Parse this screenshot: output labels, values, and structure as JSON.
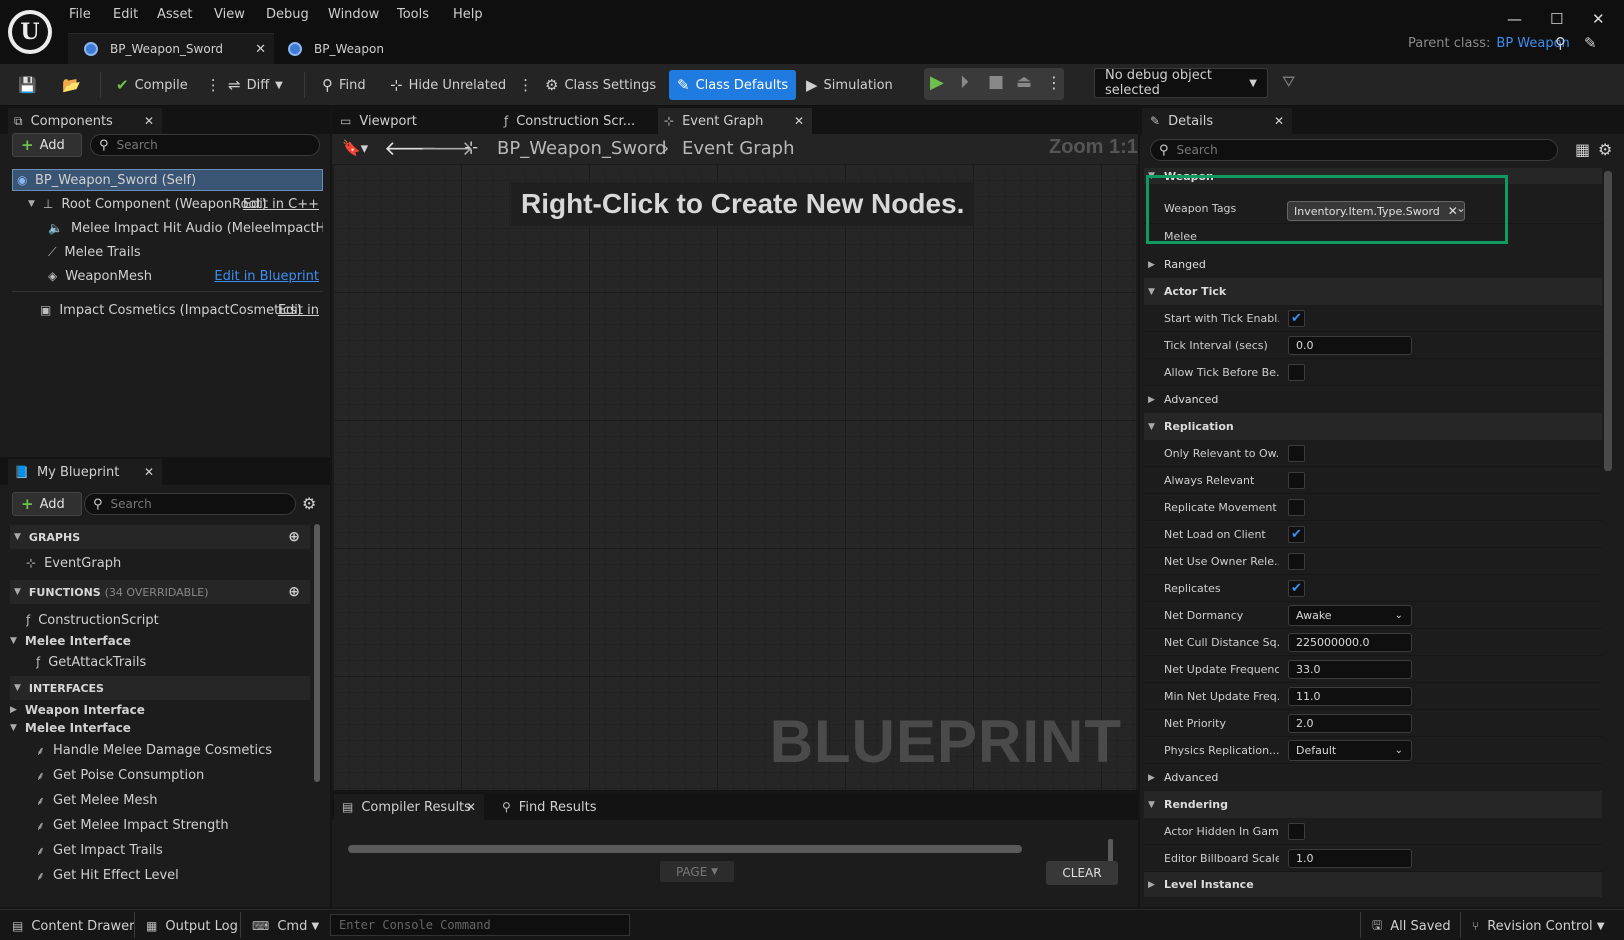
{
  "menu": [
    "File",
    "Edit",
    "Asset",
    "View",
    "Debug",
    "Window",
    "Tools",
    "Help"
  ],
  "tabs": [
    {
      "label": "BP_Weapon_Sword"
    },
    {
      "label": "BP_Weapon"
    }
  ],
  "parent_class": {
    "label": "Parent class:",
    "value": "BP Weapon"
  },
  "toolbar": {
    "compile": "Compile",
    "diff": "Diff",
    "find": "Find",
    "hide_unrelated": "Hide Unrelated",
    "class_settings": "Class Settings",
    "class_defaults": "Class Defaults",
    "simulation": "Simulation",
    "debug_object": "No debug object selected"
  },
  "components": {
    "title": "Components",
    "add": "Add",
    "search_placeholder": "Search",
    "items": [
      {
        "label": "BP_Weapon_Sword (Self)"
      },
      {
        "label": "Root Component (WeaponRoot)",
        "action": "Edit in C++"
      },
      {
        "label": "Melee Impact Hit Audio (MeleeImpactHitAuc"
      },
      {
        "label": "Melee Trails"
      },
      {
        "label": "WeaponMesh",
        "action": "Edit in Blueprint"
      },
      {
        "label": "Impact Cosmetics (ImpactCosmetics)",
        "action": "Edit in"
      }
    ]
  },
  "my_blueprint": {
    "title": "My Blueprint",
    "add": "Add",
    "search_placeholder": "Search",
    "graphs_header": "GRAPHS",
    "event_graph": "EventGraph",
    "functions_header": "FUNCTIONS",
    "functions_count": "(34 OVERRIDABLE)",
    "construction_script": "ConstructionScript",
    "melee_interface_cat": "Melee Interface",
    "get_attack_trails": "GetAttackTrails",
    "interfaces_header": "INTERFACES",
    "weapon_interface": "Weapon Interface",
    "melee_interface": "Melee Interface",
    "interface_funcs": [
      "Handle Melee Damage Cosmetics",
      "Get Poise Consumption",
      "Get Melee Mesh",
      "Get Melee Impact Strength",
      "Get Impact Trails",
      "Get Hit Effect Level"
    ]
  },
  "graph_tabs": [
    {
      "label": "Viewport"
    },
    {
      "label": "Construction Scr..."
    },
    {
      "label": "Event Graph"
    }
  ],
  "graph": {
    "breadcrumb_root": "BP_Weapon_Sword",
    "breadcrumb_current": "Event Graph",
    "zoom": "Zoom 1:1",
    "hint": "Right-Click to Create New Nodes.",
    "watermark": "BLUEPRINT"
  },
  "bottom": {
    "compiler_results": "Compiler Results",
    "find_results": "Find Results",
    "page": "PAGE",
    "clear": "CLEAR"
  },
  "details": {
    "title": "Details",
    "search_placeholder": "Search",
    "weapon_section": "Weapon",
    "weapon_tags_label": "Weapon Tags",
    "weapon_tag": "Inventory.Item.Type.Sword",
    "melee_partial": "Melee",
    "ranged": "Ranged",
    "actor_tick": "Actor Tick",
    "start_tick": "Start with Tick Enabl...",
    "tick_interval": "Tick Interval (secs)",
    "tick_interval_val": "0.0",
    "allow_tick": "Allow Tick Before Be...",
    "advanced1": "Advanced",
    "replication": "Replication",
    "only_relevant": "Only Relevant to Ow...",
    "always_relevant": "Always Relevant",
    "replicate_movement": "Replicate Movement",
    "net_load": "Net Load on Client",
    "net_use_owner": "Net Use Owner Rele...",
    "replicates": "Replicates",
    "net_dormancy": "Net Dormancy",
    "net_dormancy_val": "Awake",
    "net_cull": "Net Cull Distance Sq...",
    "net_cull_val": "225000000.0",
    "net_update": "Net Update Frequency",
    "net_update_val": "33.0",
    "min_net_update": "Min Net Update Freq...",
    "min_net_update_val": "11.0",
    "net_priority": "Net Priority",
    "net_priority_val": "2.0",
    "physics_rep": "Physics Replication...",
    "physics_rep_val": "Default",
    "advanced2": "Advanced",
    "rendering": "Rendering",
    "actor_hidden": "Actor Hidden In Game",
    "billboard_scale": "Editor Billboard Scale",
    "billboard_scale_val": "1.0",
    "level_instance": "Level Instance"
  },
  "status": {
    "content_drawer": "Content Drawer",
    "output_log": "Output Log",
    "cmd": "Cmd",
    "console_placeholder": "Enter Console Command",
    "all_saved": "All Saved",
    "revision_control": "Revision Control"
  }
}
